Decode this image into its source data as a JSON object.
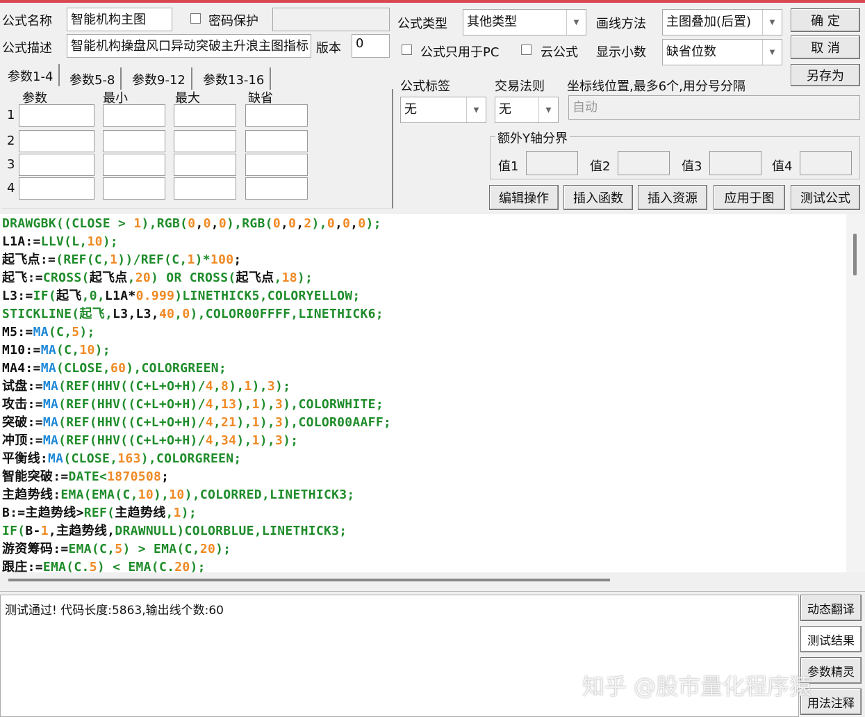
{
  "form": {
    "name_label": "公式名称",
    "name_value": "智能机构主图",
    "password_label": "密码保护",
    "desc_label": "公式描述",
    "desc_value": "智能机构操盘风口异动突破主升浪主图指标",
    "version_label": "版本",
    "version_value": "0",
    "type_label": "公式类型",
    "type_value": "其他类型",
    "draw_label": "画线方法",
    "draw_value": "主图叠加(后置)",
    "pc_only_label": "公式只用于PC",
    "cloud_label": "云公式",
    "decimal_label": "显示小数",
    "decimal_value": "缺省位数",
    "tag_label": "公式标签",
    "tag_value": "无",
    "trade_label": "交易法则",
    "trade_value": "无",
    "axis_label": "坐标线位置,最多6个,用分号分隔",
    "axis_placeholder": "自动",
    "yaxis_group": "额外Y轴分界",
    "yvals": [
      "值1",
      "值2",
      "值3",
      "值4"
    ]
  },
  "buttons": {
    "ok": "确  定",
    "cancel": "取  消",
    "save_as": "另存为",
    "edit": "编辑操作",
    "insert_func": "插入函数",
    "insert_res": "插入资源",
    "apply": "应用于图",
    "test": "测试公式",
    "translate": "动态翻译",
    "result": "测试结果",
    "wizard": "参数精灵",
    "usage": "用法注释"
  },
  "params": {
    "tabs": [
      "参数1-4",
      "参数5-8",
      "参数9-12",
      "参数13-16"
    ],
    "headers": [
      "参数",
      "最小",
      "最大",
      "缺省"
    ],
    "rows": [
      "1",
      "2",
      "3",
      "4"
    ]
  },
  "code_lines": [
    [
      [
        "g",
        "DRAWGBK((CLOSE > "
      ],
      [
        "o",
        "1"
      ],
      [
        "g",
        "),RGB("
      ],
      [
        "o",
        "0"
      ],
      [
        "k",
        ","
      ],
      [
        "o",
        "0"
      ],
      [
        "k",
        ","
      ],
      [
        "o",
        "0"
      ],
      [
        "g",
        "),RGB("
      ],
      [
        "o",
        "0"
      ],
      [
        "k",
        ","
      ],
      [
        "o",
        "0"
      ],
      [
        "k",
        ","
      ],
      [
        "o",
        "2"
      ],
      [
        "g",
        "),"
      ],
      [
        "o",
        "0"
      ],
      [
        "k",
        ","
      ],
      [
        "o",
        "0"
      ],
      [
        "k",
        ","
      ],
      [
        "o",
        "0"
      ],
      [
        "g",
        ");"
      ]
    ],
    [
      [
        "k",
        "L1A:="
      ],
      [
        "g",
        "LLV(L,"
      ],
      [
        "o",
        "10"
      ],
      [
        "g",
        ");"
      ]
    ],
    [
      [
        "k",
        "起飞点:="
      ],
      [
        "g",
        "(REF(C,"
      ],
      [
        "o",
        "1"
      ],
      [
        "g",
        "))/REF(C,"
      ],
      [
        "o",
        "1"
      ],
      [
        "g",
        ")*"
      ],
      [
        "o",
        "100"
      ],
      [
        "k",
        ";"
      ]
    ],
    [
      [
        "k",
        "起飞:="
      ],
      [
        "g",
        "CROSS("
      ],
      [
        "k",
        "起飞点"
      ],
      [
        "g",
        ","
      ],
      [
        "o",
        "20"
      ],
      [
        "g",
        ") OR CROSS("
      ],
      [
        "k",
        "起飞点"
      ],
      [
        "g",
        ","
      ],
      [
        "o",
        "18"
      ],
      [
        "g",
        ");"
      ]
    ],
    [
      [
        "k",
        "L3:="
      ],
      [
        "g",
        "IF("
      ],
      [
        "k",
        "起飞"
      ],
      [
        "g",
        ",0,"
      ],
      [
        "k",
        "L1A*"
      ],
      [
        "o",
        "0.999"
      ],
      [
        "g",
        ")LINETHICK5,COLORYELLOW;"
      ]
    ],
    [
      [
        "g",
        "STICKLINE(起飞,"
      ],
      [
        "k",
        "L3,L3,"
      ],
      [
        "o",
        "40"
      ],
      [
        "g",
        ","
      ],
      [
        "o",
        "0"
      ],
      [
        "g",
        "),COLOR00FFFF,LINETHICK6;"
      ]
    ],
    [
      [
        "k",
        "M5:="
      ],
      [
        "b",
        "MA"
      ],
      [
        "g",
        "(C,"
      ],
      [
        "o",
        "5"
      ],
      [
        "g",
        ");"
      ]
    ],
    [
      [
        "k",
        "M10:="
      ],
      [
        "b",
        "MA"
      ],
      [
        "g",
        "(C,"
      ],
      [
        "o",
        "10"
      ],
      [
        "g",
        ");"
      ]
    ],
    [
      [
        "k",
        "MA4:="
      ],
      [
        "b",
        "MA"
      ],
      [
        "g",
        "(CLOSE,"
      ],
      [
        "o",
        "60"
      ],
      [
        "g",
        "),COLORGREEN;"
      ]
    ],
    [
      [
        "k",
        "试盘:="
      ],
      [
        "b",
        "MA"
      ],
      [
        "g",
        "(REF(HHV((C+L+O+H)/"
      ],
      [
        "o",
        "4"
      ],
      [
        "g",
        ","
      ],
      [
        "o",
        "8"
      ],
      [
        "g",
        "),"
      ],
      [
        "o",
        "1"
      ],
      [
        "g",
        "),"
      ],
      [
        "o",
        "3"
      ],
      [
        "g",
        ");"
      ]
    ],
    [
      [
        "k",
        "攻击:="
      ],
      [
        "b",
        "MA"
      ],
      [
        "g",
        "(REF(HHV((C+L+O+H)/"
      ],
      [
        "o",
        "4"
      ],
      [
        "g",
        ","
      ],
      [
        "o",
        "13"
      ],
      [
        "g",
        "),"
      ],
      [
        "o",
        "1"
      ],
      [
        "g",
        "),"
      ],
      [
        "o",
        "3"
      ],
      [
        "g",
        "),COLORWHITE;"
      ]
    ],
    [
      [
        "k",
        "突破:="
      ],
      [
        "b",
        "MA"
      ],
      [
        "g",
        "(REF(HHV((C+L+O+H)/"
      ],
      [
        "o",
        "4"
      ],
      [
        "g",
        ","
      ],
      [
        "o",
        "21"
      ],
      [
        "g",
        "),"
      ],
      [
        "o",
        "1"
      ],
      [
        "g",
        "),"
      ],
      [
        "o",
        "3"
      ],
      [
        "g",
        "),COLOR00AAFF;"
      ]
    ],
    [
      [
        "k",
        "冲顶:="
      ],
      [
        "b",
        "MA"
      ],
      [
        "g",
        "(REF(HHV((C+L+O+H)/"
      ],
      [
        "o",
        "4"
      ],
      [
        "g",
        ","
      ],
      [
        "o",
        "34"
      ],
      [
        "g",
        "),"
      ],
      [
        "o",
        "1"
      ],
      [
        "g",
        "),"
      ],
      [
        "o",
        "3"
      ],
      [
        "g",
        ");"
      ]
    ],
    [
      [
        "k",
        "平衡线:"
      ],
      [
        "b",
        "MA"
      ],
      [
        "g",
        "(CLOSE,"
      ],
      [
        "o",
        "163"
      ],
      [
        "g",
        "),COLORGREEN;"
      ]
    ],
    [
      [
        "k",
        "智能突破:="
      ],
      [
        "g",
        "DATE<"
      ],
      [
        "o",
        "1870508"
      ],
      [
        "k",
        ";"
      ]
    ],
    [
      [
        "k",
        "主趋势线:"
      ],
      [
        "g",
        "EMA(EMA(C,"
      ],
      [
        "o",
        "10"
      ],
      [
        "g",
        "),"
      ],
      [
        "o",
        "10"
      ],
      [
        "g",
        "),COLORRED,LINETHICK3;"
      ]
    ],
    [
      [
        "k",
        "B:=主趋势线>"
      ],
      [
        "g",
        "REF("
      ],
      [
        "k",
        "主趋势线"
      ],
      [
        "g",
        ","
      ],
      [
        "o",
        "1"
      ],
      [
        "g",
        ");"
      ]
    ],
    [
      [
        "g",
        "IF("
      ],
      [
        "k",
        "B-"
      ],
      [
        "o",
        "1"
      ],
      [
        "k",
        ",主趋势线,"
      ],
      [
        "g",
        "DRAWNULL)COLORBLUE,LINETHICK3;"
      ]
    ],
    [
      [
        "k",
        "游资筹码:="
      ],
      [
        "g",
        "EMA(C,"
      ],
      [
        "o",
        "5"
      ],
      [
        "g",
        ") > EMA(C,"
      ],
      [
        "o",
        "20"
      ],
      [
        "g",
        ");"
      ]
    ],
    [
      [
        "k",
        "跟庄:="
      ],
      [
        "g",
        "EMA(C."
      ],
      [
        "o",
        "5"
      ],
      [
        "g",
        ") < EMA(C."
      ],
      [
        "o",
        "20"
      ],
      [
        "g",
        ");"
      ]
    ]
  ],
  "output": {
    "message": "测试通过! 代码长度:5863,输出线个数:60"
  },
  "watermark": "知乎 @股市量化程序猿"
}
